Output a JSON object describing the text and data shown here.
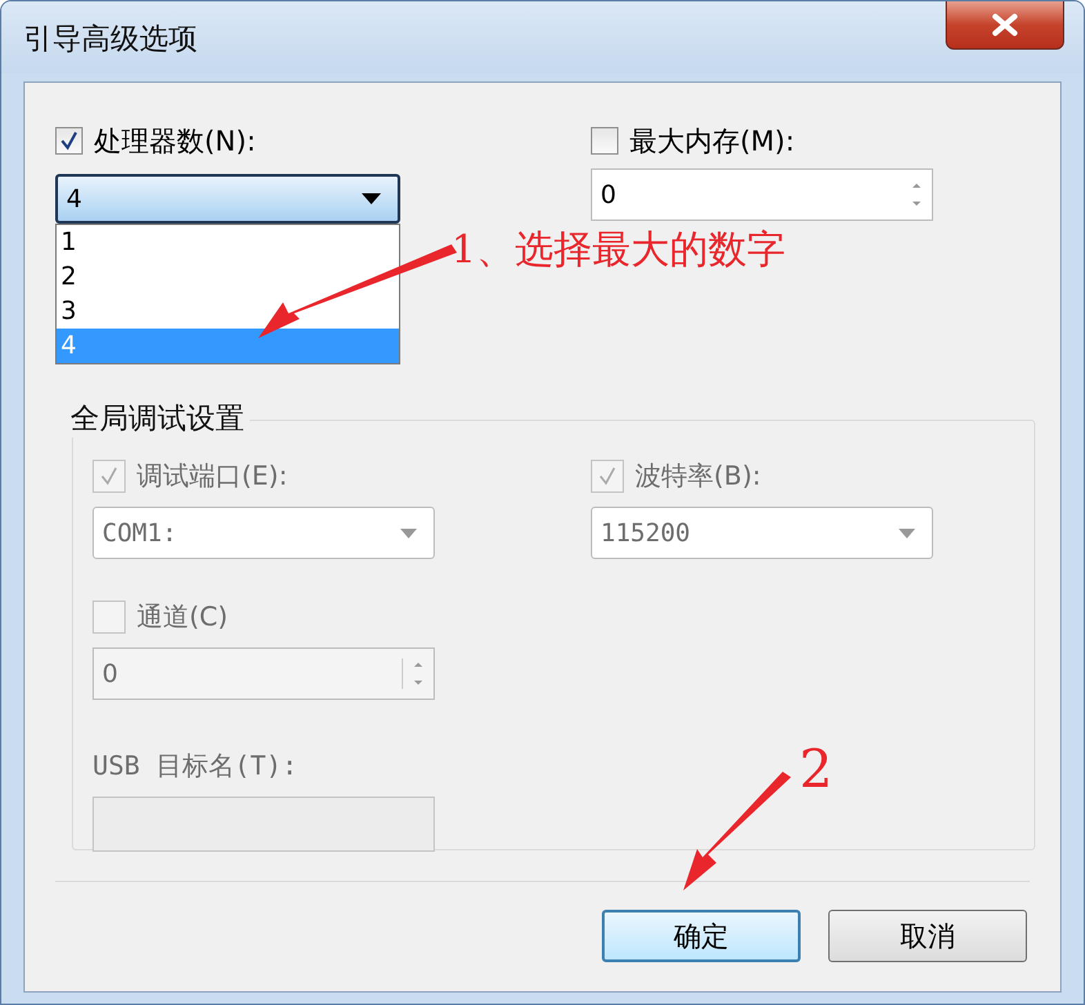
{
  "window": {
    "title": "引导高级选项"
  },
  "processors": {
    "label": "处理器数(N):",
    "checked": true,
    "value": "4",
    "expanded": true,
    "options": [
      {
        "label": "1",
        "selected": false
      },
      {
        "label": "2",
        "selected": false
      },
      {
        "label": "3",
        "selected": false
      },
      {
        "label": "4",
        "selected": true
      }
    ]
  },
  "max_memory": {
    "label": "最大内存(M):",
    "checked": false,
    "value": "0"
  },
  "debug_group": {
    "title": "全局调试设置",
    "fields": [
      {
        "kind": "combo",
        "label": "调试端口(E):",
        "checked": true,
        "disabled": true,
        "value": "COM1:"
      },
      {
        "kind": "combo",
        "label": "波特率(B):",
        "checked": true,
        "disabled": true,
        "value": "115200"
      },
      {
        "kind": "spin",
        "label": "通道(C)",
        "checked": false,
        "disabled": true,
        "value": "0"
      },
      {
        "kind": "text",
        "label": "USB 目标名(T):",
        "disabled": true
      }
    ]
  },
  "buttons": [
    {
      "label": "确定",
      "default": true
    },
    {
      "label": "取消",
      "default": false
    }
  ],
  "annotations": [
    {
      "text": "1、选择最大的数字"
    },
    {
      "text": "2"
    }
  ]
}
